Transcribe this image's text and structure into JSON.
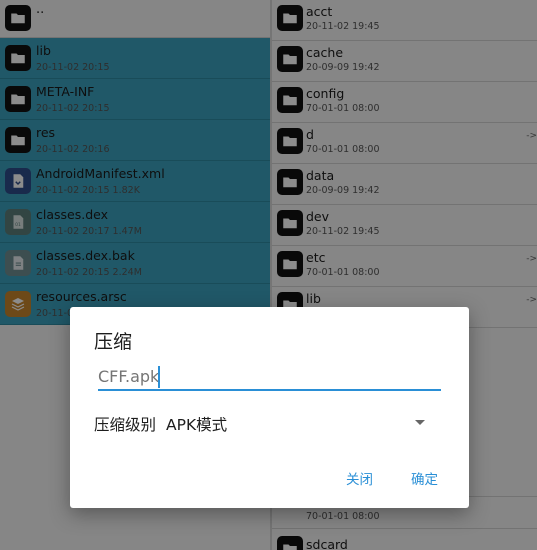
{
  "left_pane": {
    "parent_label": "..",
    "items": [
      {
        "name": "lib",
        "meta": "20-11-02 20:15",
        "icon": "folder-icon",
        "kind": "folder",
        "selected": true
      },
      {
        "name": "META-INF",
        "meta": "20-11-02 20:15",
        "icon": "folder-icon",
        "kind": "folder",
        "selected": true
      },
      {
        "name": "res",
        "meta": "20-11-02 20:16",
        "icon": "folder-icon",
        "kind": "folder",
        "selected": true
      },
      {
        "name": "AndroidManifest.xml",
        "meta": "20-11-02 20:15  1.82K",
        "icon": "xml-file-icon",
        "kind": "xml",
        "selected": true
      },
      {
        "name": "classes.dex",
        "meta": "20-11-02 20:17  1.47M",
        "icon": "dex-file-icon",
        "kind": "dex",
        "selected": true
      },
      {
        "name": "classes.dex.bak",
        "meta": "20-11-02 20:15  2.24M",
        "icon": "file-icon",
        "kind": "bak",
        "selected": true
      },
      {
        "name": "resources.arsc",
        "meta": "20-11-02",
        "icon": "layers-file-icon",
        "kind": "arsc",
        "selected": true
      }
    ]
  },
  "right_pane": {
    "items": [
      {
        "name": "acct",
        "meta": "20-11-02 19:45",
        "link": ""
      },
      {
        "name": "cache",
        "meta": "20-09-09 19:42",
        "link": ""
      },
      {
        "name": "config",
        "meta": "70-01-01 08:00",
        "link": ""
      },
      {
        "name": "d",
        "meta": "70-01-01 08:00",
        "link": "->"
      },
      {
        "name": "data",
        "meta": "20-09-09 19:42",
        "link": ""
      },
      {
        "name": "dev",
        "meta": "20-11-02 19:45",
        "link": ""
      },
      {
        "name": "etc",
        "meta": "70-01-01 08:00",
        "link": "->"
      },
      {
        "name": "lib",
        "meta": "",
        "link": "->"
      }
    ],
    "bottom_items": [
      {
        "name": "",
        "meta": "70-01-01 08:00"
      },
      {
        "name": "sdcard",
        "meta": ""
      }
    ]
  },
  "dialog": {
    "title": "压缩",
    "filename_placeholder": "CFF.apk",
    "level_label": "压缩级别",
    "level_value": "APK模式",
    "close_label": "关闭",
    "ok_label": "确定"
  },
  "colors": {
    "selection": "#3ba0bd",
    "accent": "#2a8fd6"
  }
}
